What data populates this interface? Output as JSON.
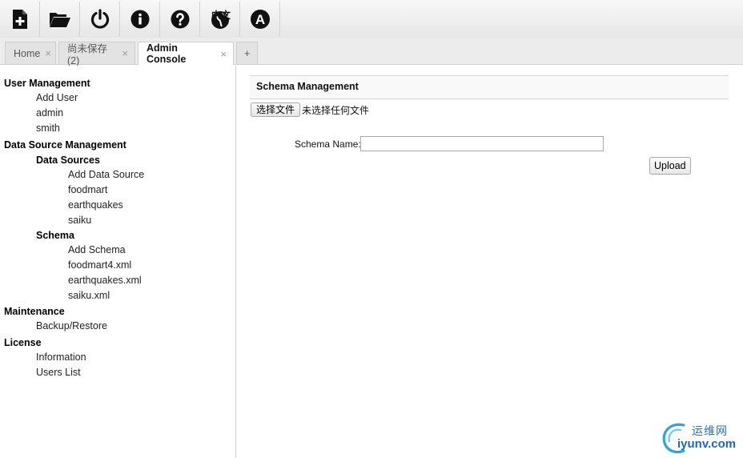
{
  "toolbar": {
    "buttons": [
      {
        "id": "new",
        "icon": "new-file-icon"
      },
      {
        "id": "open",
        "icon": "folder-open-icon"
      },
      {
        "id": "logout",
        "icon": "power-icon"
      },
      {
        "id": "about",
        "icon": "info-icon"
      },
      {
        "id": "help",
        "icon": "help-icon"
      },
      {
        "id": "language",
        "icon": "globe-icon",
        "label": "中文"
      },
      {
        "id": "admin",
        "icon": "admin-a-icon",
        "label": "A"
      }
    ]
  },
  "tabs": {
    "items": [
      {
        "label": "Home",
        "close": "×"
      },
      {
        "label": "尚未保存 (2)",
        "close": "×"
      },
      {
        "label": "Admin Console",
        "close": "×"
      }
    ],
    "add_label": "+"
  },
  "sidebar": {
    "user_management": {
      "title": "User Management",
      "items": [
        "Add User",
        "admin",
        "smith"
      ]
    },
    "data_source_management": {
      "title": "Data Source Management",
      "data_sources": {
        "title": "Data Sources",
        "items": [
          "Add Data Source",
          "foodmart",
          "earthquakes",
          "saiku"
        ]
      },
      "schema": {
        "title": "Schema",
        "items": [
          "Add Schema",
          "foodmart4.xml",
          "earthquakes.xml",
          "saiku.xml"
        ]
      }
    },
    "maintenance": {
      "title": "Maintenance",
      "items": [
        "Backup/Restore"
      ]
    },
    "license": {
      "title": "License",
      "items": [
        "Information",
        "Users List"
      ]
    }
  },
  "main": {
    "panel_title": "Schema Management",
    "file_button_label": "选择文件",
    "file_status": "未选择任何文件",
    "schema_name_label": "Schema Name:",
    "schema_name_value": "",
    "upload_label": "Upload"
  },
  "watermark": {
    "cn": "运维网",
    "en": "iyunv.com"
  }
}
